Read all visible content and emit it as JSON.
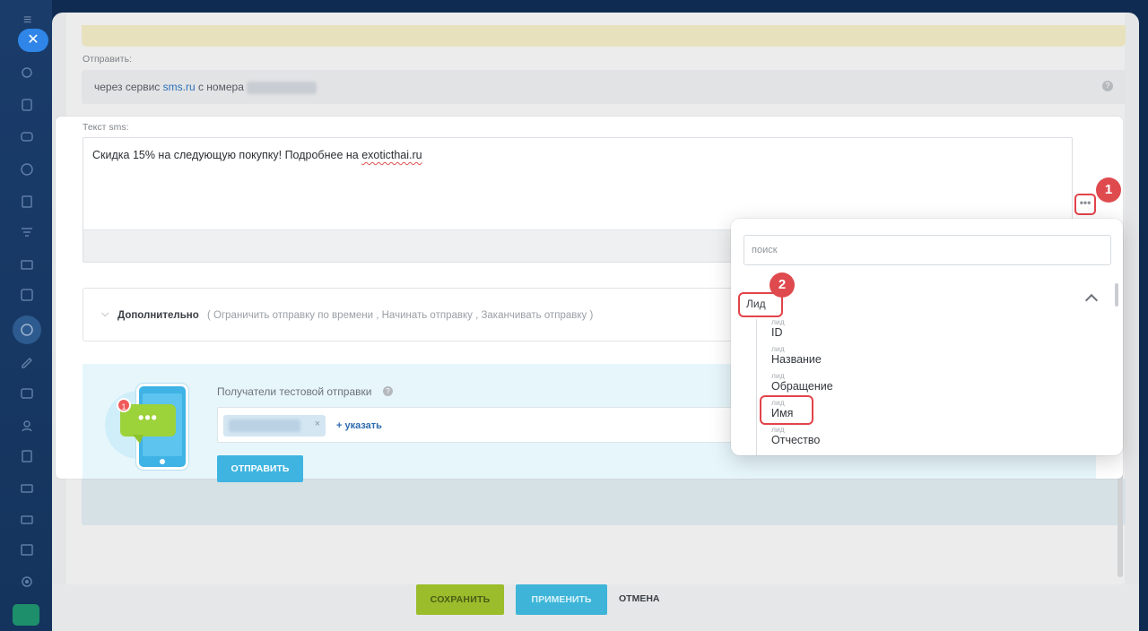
{
  "colors": {
    "accent_blue": "#2f86e8",
    "badge_red": "#df4a4e",
    "save_green": "#9bbd2c",
    "apply_blue": "#3eb5d8",
    "link_blue": "#2e70b8"
  },
  "sidebar": {
    "icons": [
      "menu-icon",
      "close-icon",
      "refresh-icon",
      "tasks-icon",
      "chat-icon",
      "globe-icon",
      "document-icon",
      "filter-icon",
      "mail-icon",
      "checkbox-icon",
      "crm-icon",
      "pen-icon",
      "video-icon",
      "contacts-icon",
      "file-icon",
      "card-icon",
      "store-icon",
      "calendar-icon",
      "settings-icon",
      "rocket-icon"
    ]
  },
  "background": {
    "send_label": "Отправить:",
    "send_prefix": "через сервис",
    "send_service": "sms.ru",
    "send_suffix": "с номера",
    "save_label": "СОХРАНИТЬ",
    "apply_label": "ПРИМЕНИТЬ",
    "cancel_label": "ОТМЕНА"
  },
  "modal": {
    "sms_label": "Текст sms:",
    "sms_text_main": "Скидка 15% на следующую покупку! Подробнее на",
    "sms_text_link": "exoticthai.ru",
    "more_button": "•••",
    "extra_title": "Дополнительно",
    "extra_rest": "( Ограничить отправку по времени ,  Начинать отправку ,  Заканчивать отправку  )",
    "test_recipients_label": "Получатели тестовой отправки",
    "add_recipient": "+ указать",
    "send_button": "ОТПРАВИТЬ",
    "notif_count": "1",
    "bubble_dots": "•••"
  },
  "badges": {
    "first": "1",
    "second": "2"
  },
  "popup": {
    "search_placeholder": "поиск",
    "group": "Лид",
    "items": [
      {
        "caption": "лид",
        "title": "ID"
      },
      {
        "caption": "лид",
        "title": "Название"
      },
      {
        "caption": "лид",
        "title": "Обращение"
      },
      {
        "caption": "лид",
        "title": "Имя"
      },
      {
        "caption": "лид",
        "title": "Отчество"
      }
    ]
  }
}
